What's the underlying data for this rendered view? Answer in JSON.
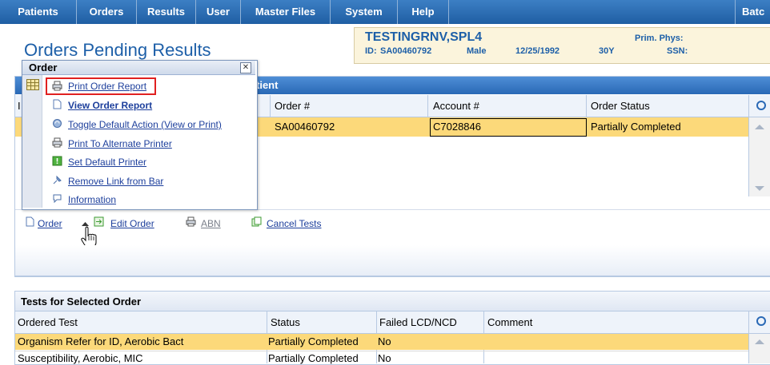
{
  "menu": {
    "items": [
      "Patients",
      "Orders",
      "Results",
      "User",
      "Master Files",
      "System",
      "Help"
    ],
    "right_item": "Batc"
  },
  "page": {
    "title": "Orders Pending Results"
  },
  "patient": {
    "name": "TESTINGRNV,SPL4",
    "id_label": "ID:",
    "id": "SA00460792",
    "sex": "Male",
    "dob": "12/25/1992",
    "age": "30Y",
    "prim_phys_label": "Prim. Phys:",
    "ssn_label": "SSN:"
  },
  "popup": {
    "title": "Order",
    "close_glyph": "✕",
    "items": [
      {
        "label": "Print Order Report",
        "icon": "printer-icon",
        "bold": false,
        "highlighted": true
      },
      {
        "label": "View Order Report",
        "icon": "document-icon",
        "bold": true,
        "highlighted": false
      },
      {
        "label": "Toggle Default Action (View or Print)",
        "icon": "toggle-icon",
        "bold": false,
        "highlighted": false
      },
      {
        "label": "Print To Alternate Printer",
        "icon": "printer-icon",
        "bold": false,
        "highlighted": false
      },
      {
        "label": "Set Default Printer",
        "icon": "default-printer-icon",
        "bold": false,
        "highlighted": false
      },
      {
        "label": "Remove Link from Bar",
        "icon": "pin-icon",
        "bold": false,
        "highlighted": false
      },
      {
        "label": "Information",
        "icon": "info-bubble-icon",
        "bold": false,
        "highlighted": false
      }
    ]
  },
  "orders_grid": {
    "header_title_fragment": "tient",
    "col_partial": "I",
    "columns": [
      "Order #",
      "Account #",
      "Order Status"
    ],
    "rows": [
      {
        "order": "SA00460792",
        "account": "C7028846",
        "status": "Partially Completed"
      }
    ]
  },
  "actions": {
    "order": "Order",
    "edit_order": "Edit Order",
    "abn": "ABN",
    "cancel_tests": "Cancel Tests"
  },
  "tests_grid": {
    "title": "Tests for Selected Order",
    "columns": [
      "Ordered Test",
      "Status",
      "Failed LCD/NCD",
      "Comment"
    ],
    "rows": [
      {
        "test": "Organism Refer for ID, Aerobic Bact",
        "status": "Partially Completed",
        "failed": "No",
        "comment": ""
      },
      {
        "test": "Susceptibility, Aerobic, MIC",
        "status": "Partially Completed",
        "failed": "No",
        "comment": ""
      }
    ]
  },
  "colors": {
    "menu_bg": "#1f5ea3",
    "accent": "#1d5fa8",
    "selected_row": "#fcd97a",
    "highlight_border": "#e02020"
  }
}
